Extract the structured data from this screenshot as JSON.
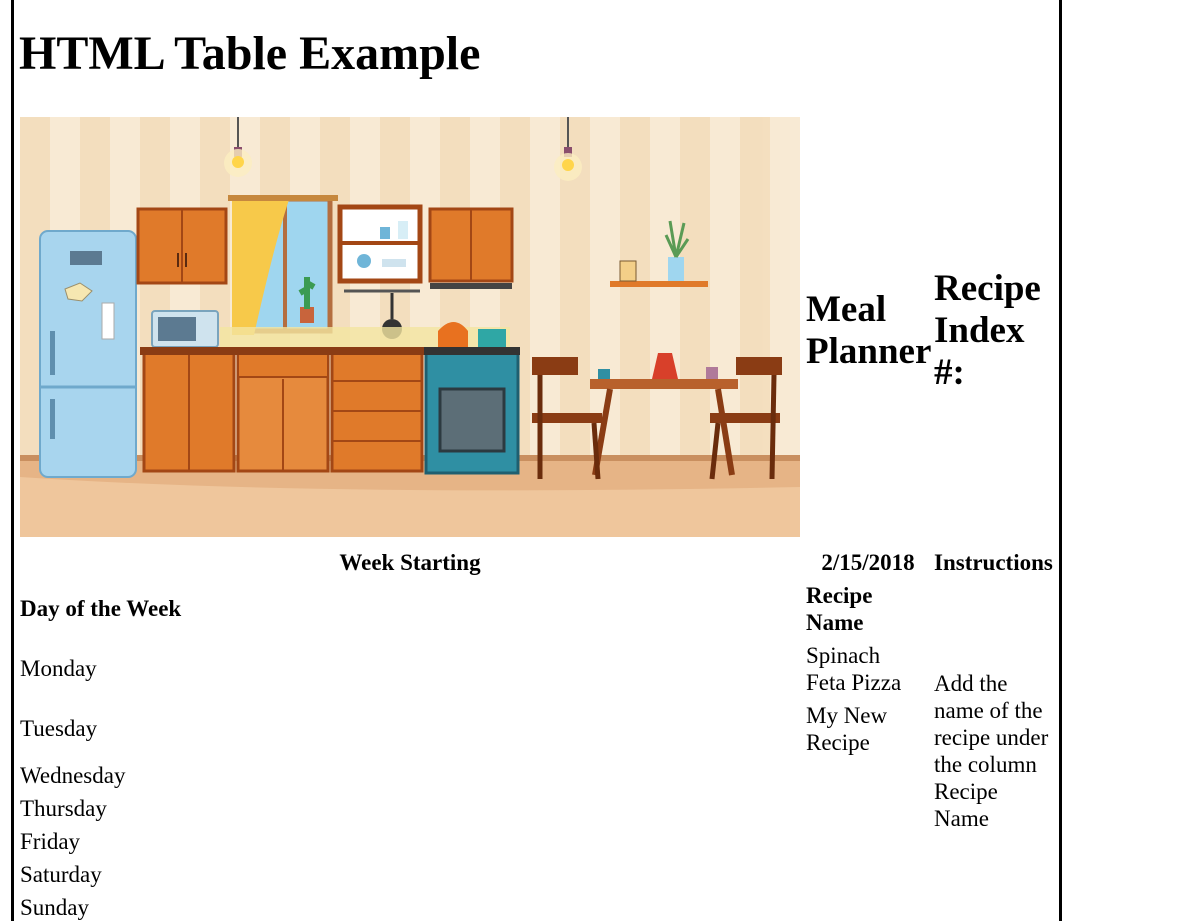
{
  "page": {
    "title": "HTML Table Example"
  },
  "header_row": {
    "meal_planner": "Meal Planner",
    "recipe_index": "Recipe Index #:"
  },
  "week_row": {
    "label": "Week Starting",
    "date": "2/15/2018",
    "instructions_header": "Instructions"
  },
  "columns": {
    "day": "Day of the Week",
    "recipe": "Recipe Name"
  },
  "days": [
    "Monday",
    "Tuesday",
    "Wednesday",
    "Thursday",
    "Friday",
    "Saturday",
    "Sunday"
  ],
  "recipes": [
    "Spinach Feta Pizza",
    "My New Recipe"
  ],
  "instructions_text": "Add the name of the recipe under the column Recipe Name",
  "image": {
    "subject": "kitchen-illustration"
  }
}
